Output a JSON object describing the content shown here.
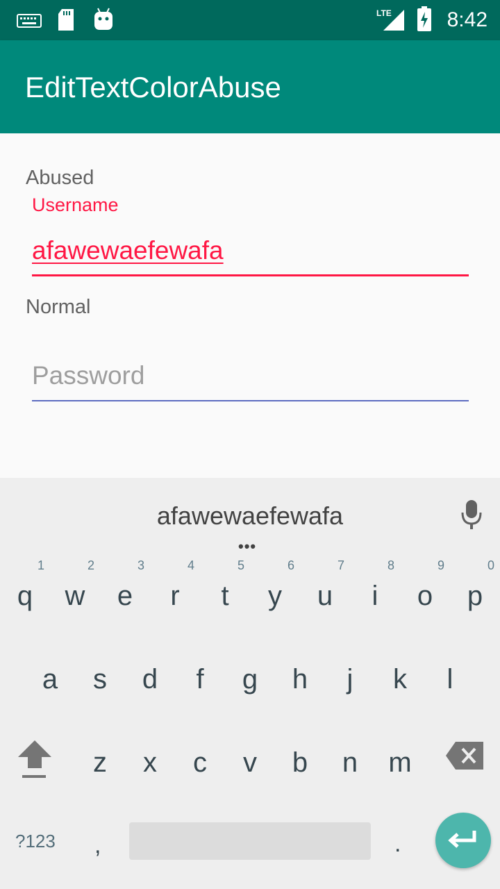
{
  "status_bar": {
    "time": "8:42",
    "network_label": "LTE",
    "icons": [
      "keyboard-icon",
      "sd-card-icon",
      "android-icon",
      "signal-icon",
      "battery-icon"
    ]
  },
  "app_bar": {
    "title": "EditTextColorAbuse",
    "color": "#00897b",
    "status_color": "#00695c"
  },
  "form": {
    "abused": {
      "section_label": "Abused",
      "floating_label": "Username",
      "value": "afawewaefewafa",
      "accent_color": "#ff1744"
    },
    "normal": {
      "section_label": "Normal",
      "placeholder": "Password",
      "accent_color": "#3f51b5"
    }
  },
  "keyboard": {
    "suggestion": "afawewaefewafa",
    "more_suggestions": "•••",
    "row1": [
      {
        "letter": "q",
        "hint": "1"
      },
      {
        "letter": "w",
        "hint": "2"
      },
      {
        "letter": "e",
        "hint": "3"
      },
      {
        "letter": "r",
        "hint": "4"
      },
      {
        "letter": "t",
        "hint": "5"
      },
      {
        "letter": "y",
        "hint": "6"
      },
      {
        "letter": "u",
        "hint": "7"
      },
      {
        "letter": "i",
        "hint": "8"
      },
      {
        "letter": "o",
        "hint": "9"
      },
      {
        "letter": "p",
        "hint": "0"
      }
    ],
    "row2": [
      "a",
      "s",
      "d",
      "f",
      "g",
      "h",
      "j",
      "k",
      "l"
    ],
    "row3": [
      "z",
      "x",
      "c",
      "v",
      "b",
      "n",
      "m"
    ],
    "symbols_key": "?123",
    "comma_key": ",",
    "period_key": ".",
    "enter_color": "#4db6ac"
  }
}
